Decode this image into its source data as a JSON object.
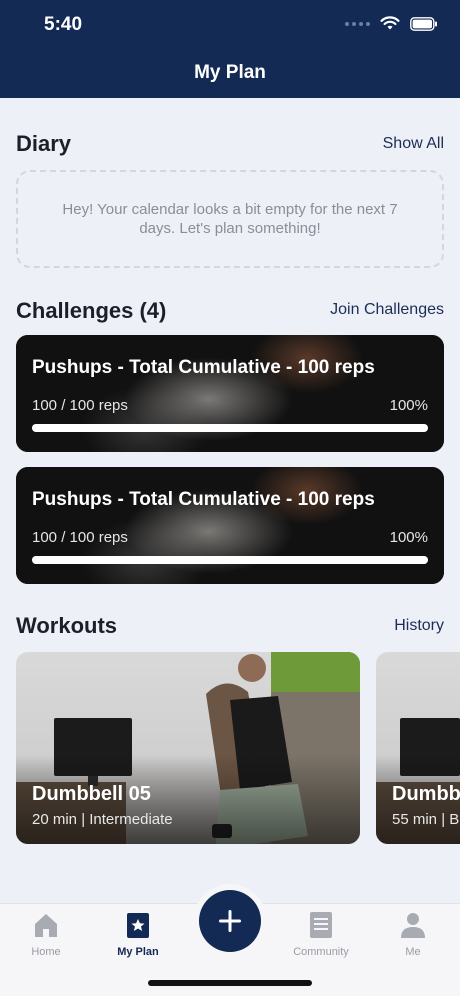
{
  "status": {
    "time": "5:40"
  },
  "header": {
    "title": "My Plan"
  },
  "diary": {
    "title": "Diary",
    "link": "Show All",
    "empty_text": "Hey! Your calendar looks a bit empty for the next 7 days. Let's plan something!"
  },
  "challenges": {
    "title": "Challenges (4)",
    "link": "Join Challenges",
    "items": [
      {
        "title": "Pushups - Total Cumulative - 100 reps",
        "progress_text": "100 / 100 reps",
        "percent": "100%",
        "progress": 1.0
      },
      {
        "title": "Pushups - Total Cumulative - 100 reps",
        "progress_text": "100 / 100 reps",
        "percent": "100%",
        "progress": 1.0
      }
    ]
  },
  "workouts": {
    "title": "Workouts",
    "link": "History",
    "items": [
      {
        "name": "Dumbbell 05",
        "meta": "20 min | Intermediate"
      },
      {
        "name": "Dumbb",
        "meta": "55 min | B"
      }
    ]
  },
  "tabbar": {
    "items": [
      {
        "label": "Home",
        "icon": "home-icon"
      },
      {
        "label": "My Plan",
        "icon": "star-calendar-icon"
      },
      {
        "label": "Community",
        "icon": "document-icon"
      },
      {
        "label": "Me",
        "icon": "person-icon"
      }
    ],
    "fab_icon": "plus-icon"
  },
  "colors": {
    "primary": "#132a54",
    "background": "#eef0f7"
  }
}
